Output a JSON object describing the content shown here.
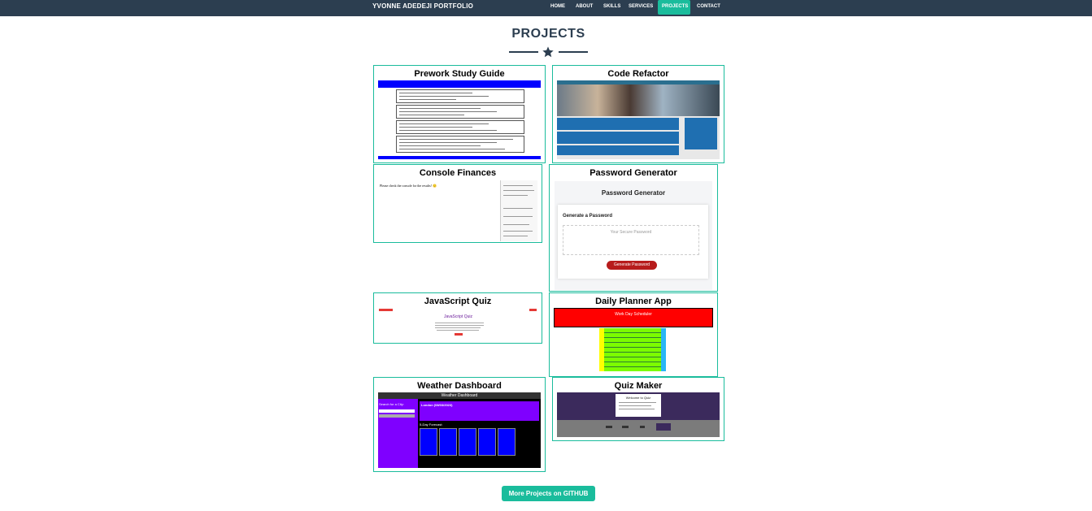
{
  "navbar": {
    "brand": "YVONNE ADEDEJI PORTFOLIO",
    "items": [
      {
        "label": "HOME",
        "active": false
      },
      {
        "label": "ABOUT",
        "active": false
      },
      {
        "label": "SKILLS",
        "active": false
      },
      {
        "label": "SERVICES",
        "active": false
      },
      {
        "label": "PROJECTS",
        "active": true
      },
      {
        "label": "CONTACT",
        "active": false
      }
    ]
  },
  "colors": {
    "primary": "#2c3e50",
    "accent": "#1abc9c"
  },
  "section": {
    "title": "PROJECTS",
    "divider_icon": "star-icon"
  },
  "projects": [
    {
      "title": "Prework Study Guide"
    },
    {
      "title": "Code Refactor"
    },
    {
      "title": "Console Finances",
      "thumb_text": "Please check the console for the results! 🙂"
    },
    {
      "title": "Password Generator",
      "thumb_heading": "Password Generator",
      "thumb_sub": "Generate a Password",
      "thumb_placeholder": "Your Secure Password",
      "thumb_button": "Generate Password"
    },
    {
      "title": "JavaScript Quiz",
      "thumb_heading": "JavaScript Quiz"
    },
    {
      "title": "Daily Planner App",
      "thumb_heading": "Work Day Scheduler"
    },
    {
      "title": "Weather Dashboard",
      "thumb_heading": "Weather Dashboard",
      "thumb_search": "Search for a City:",
      "thumb_city": "London (08/03/2023)",
      "thumb_forecast": "5-Day Forecast:"
    },
    {
      "title": "Quiz Maker",
      "thumb_heading": "Welcome to Quiz"
    }
  ],
  "github_button": "More Projects on GITHUB"
}
